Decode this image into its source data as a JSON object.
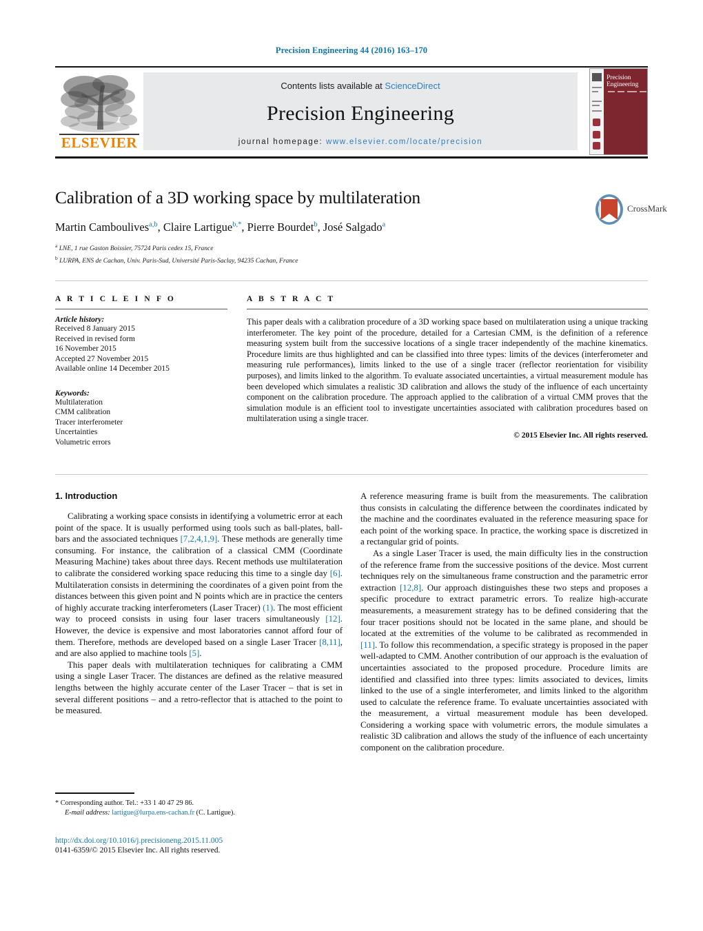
{
  "running_head": "Precision Engineering 44 (2016) 163–170",
  "masthead": {
    "contents_prefix": "Contents lists available at ",
    "sciencedirect": "ScienceDirect",
    "journal_name": "Precision Engineering",
    "homepage_label": "journal homepage:",
    "homepage_url": "www.elsevier.com/locate/precision",
    "publisher": "ELSEVIER",
    "cover_title_line1": "Precision",
    "cover_title_line2": "Engineering",
    "accent_blue": "#2e7fbd",
    "elsevier_orange": "#ef8200",
    "cover_red": "#7e2630"
  },
  "article": {
    "title": "Calibration of a 3D working space by multilateration",
    "authors": [
      {
        "name": "Martin Camboulives",
        "marks": "a,b",
        "sep": ", "
      },
      {
        "name": "Claire Lartigue",
        "marks": "b,*",
        "sep": ", "
      },
      {
        "name": "Pierre Bourdet",
        "marks": "b",
        "sep": ", "
      },
      {
        "name": "José Salgado",
        "marks": "a",
        "sep": ""
      }
    ],
    "affiliations": [
      {
        "mark": "a",
        "text": "LNE, 1 rue Gaston Boissier, 75724 Paris cedex 15, France"
      },
      {
        "mark": "b",
        "text": "LURPA, ENS de Cachan, Univ. Paris-Sud, Université Paris-Saclay, 94235 Cachan, France"
      }
    ],
    "crossmark_label": "CrossMark"
  },
  "article_info": {
    "heading": "A R T I C L E   I N F O",
    "history_label": "Article history:",
    "history": [
      "Received 8 January 2015",
      "Received in revised form",
      "16 November 2015",
      "Accepted 27 November 2015",
      "Available online 14 December 2015"
    ],
    "keywords_label": "Keywords:",
    "keywords": [
      "Multilateration",
      "CMM calibration",
      "Tracer interferometer",
      "Uncertainties",
      "Volumetric errors"
    ]
  },
  "abstract": {
    "heading": "A B S T R A C T",
    "text": "This paper deals with a calibration procedure of a 3D working space based on multilateration using a unique tracking interferometer. The key point of the procedure, detailed for a Cartesian CMM, is the definition of a reference measuring system built from the successive locations of a single tracer independently of the machine kinematics. Procedure limits are thus highlighted and can be classified into three types: limits of the devices (interferometer and measuring rule performances), limits linked to the use of a single tracer (reflector reorientation for visibility purposes), and limits linked to the algorithm. To evaluate associated uncertainties, a virtual measurement module has been developed which simulates a realistic 3D calibration and allows the study of the influence of each uncertainty component on the calibration procedure. The approach applied to the calibration of a virtual CMM proves that the simulation module is an efficient tool to investigate uncertainties associated with calibration procedures based on multilateration using a single tracer.",
    "copyright": "© 2015 Elsevier Inc. All rights reserved."
  },
  "body": {
    "section_heading": "1. Introduction",
    "left_p1_a": "Calibrating a working space consists in identifying a volumetric error at each point of the space. It is usually performed using tools such as ball-plates, ball-bars and the associated techniques ",
    "left_p1_r1": "[7,2,4,1,9]",
    "left_p1_b": ". These methods are generally time consuming. For instance, the calibration of a classical CMM (Coordinate Measuring Machine) takes about three days. Recent methods use multilateration to calibrate the considered working space reducing this time to a single day ",
    "left_p1_r2": "[6]",
    "left_p1_c": ". Multilateration consists in determining the coordinates of a given point from the distances between this given point and N points which are in practice the centers of highly accurate tracking interferometers (Laser Tracer) ",
    "left_p1_r3": "(1)",
    "left_p1_d": ". The most efficient way to proceed consists in using four laser tracers simultaneously ",
    "left_p1_r4": "[12]",
    "left_p1_e": ". However, the device is expensive and most laboratories cannot afford four of them. Therefore, methods are developed based on a single Laser Tracer ",
    "left_p1_r5": "[8,11]",
    "left_p1_f": ", and are also applied to machine tools ",
    "left_p1_r6": "[5]",
    "left_p1_g": ".",
    "left_p2": "This paper deals with multilateration techniques for calibrating a CMM using a single Laser Tracer. The distances are defined as the relative measured lengths between the highly accurate center of the Laser Tracer – that is set in several different positions – and a retro-reflector that is attached to the point to be measured.",
    "right_p1": "A reference measuring frame is built from the measurements. The calibration thus consists in calculating the difference between the coordinates indicated by the machine and the coordinates evaluated in the reference measuring space for each point of the working space. In practice, the working space is discretized in a rectangular grid of points.",
    "right_p2_a": "As a single Laser Tracer is used, the main difficulty lies in the construction of the reference frame from the successive positions of the device. Most current techniques rely on the simultaneous frame construction and the parametric error extraction ",
    "right_p2_r1": "[12,8]",
    "right_p2_b": ". Our approach distinguishes these two steps and proposes a specific procedure to extract parametric errors. To realize high-accurate measurements, a measurement strategy has to be defined considering that the four tracer positions should not be located in the same plane, and should be located at the extremities of the volume to be calibrated as recommended in ",
    "right_p2_r2": "[11]",
    "right_p2_c": ". To follow this recommendation, a specific strategy is proposed in the paper well-adapted to CMM. Another contribution of our approach is the evaluation of uncertainties associated to the proposed procedure. Procedure limits are identified and classified into three types: limits associated to devices, limits linked to the use of a single interferometer, and limits linked to the algorithm used to calculate the reference frame. To evaluate uncertainties associated with the measurement, a virtual measurement module has been developed. Considering a working space with volumetric errors, the module simulates a realistic 3D calibration and allows the study of the influence of each uncertainty component on the calibration procedure."
  },
  "footnote": {
    "star": "*",
    "corresponding": "Corresponding author. Tel.: +33 1 40 47 29 86.",
    "email_label": "E-mail address:",
    "email": "lartigue@lurpa.ens-cachan.fr",
    "email_owner": "(C. Lartigue)."
  },
  "footer": {
    "doi": "http://dx.doi.org/10.1016/j.precisioneng.2015.11.005",
    "issn_copyright": "0141-6359/© 2015 Elsevier Inc. All rights reserved."
  }
}
